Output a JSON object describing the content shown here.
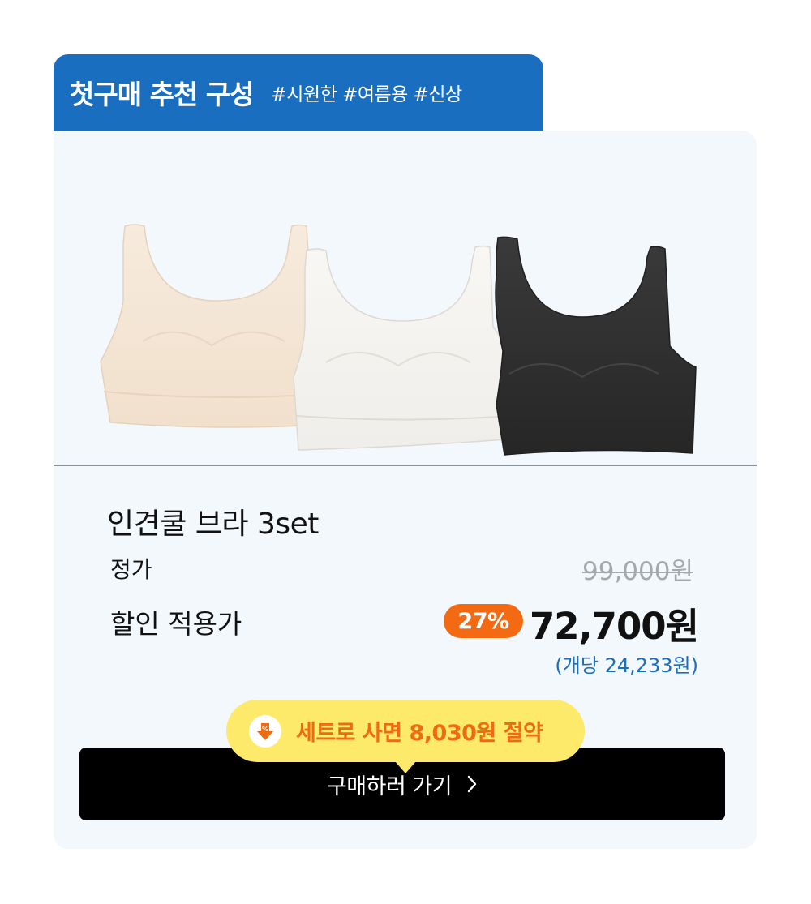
{
  "header": {
    "title": "첫구매 추천 구성",
    "tags": "#시원한 #여름용 #신상"
  },
  "product": {
    "name": "인견쿨 브라 3set",
    "image_colors": [
      "#f4e6d6",
      "#f6f5f2",
      "#2e2e2e"
    ]
  },
  "pricing": {
    "regular_label": "정가",
    "regular_price": "99,000원",
    "sale_label": "할인 적용가",
    "discount": "27%",
    "sale_price": "72,700원",
    "unit_price": "(개당 24,233원)"
  },
  "savings": {
    "icon": "percent-down-icon",
    "text": "세트로 사면 8,030원 절약"
  },
  "buy_button": {
    "label": "구매하러 가기",
    "icon": "chevron-right-icon"
  },
  "colors": {
    "brand_blue": "#1a6ebf",
    "accent_orange": "#f46a12",
    "bubble_yellow": "#fde96a"
  }
}
